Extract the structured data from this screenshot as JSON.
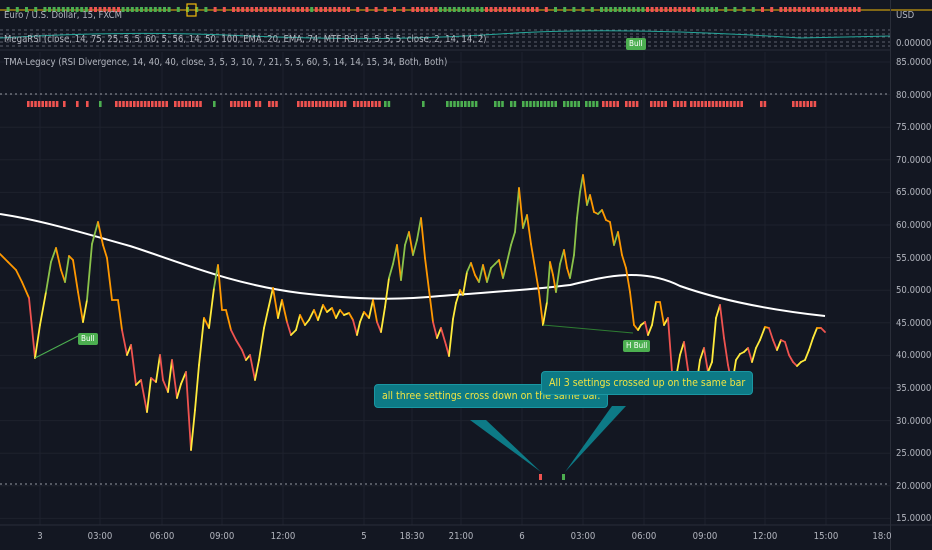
{
  "top_pane": {
    "symbol_legend": "Euro / U.S. Dollar, 15, FXCM",
    "megarsi_legend": "MegaRSI (close, 14, 75, 25, 5, 5, 60, 5, 56, 14, 50, 100, EMA, 20, EMA, 74, MTF RSI, 5, 5, 5, 5, close, 2, 14, 14, 2)",
    "currency_label": "USD",
    "zero_label": "0.00000",
    "megarsi_marker": "Bull"
  },
  "main_pane": {
    "indicator_legend": "TMA-Legacy (RSI Divergence, 14, 40, 40, close, 3, 5, 3, 10, 7, 21, 5, 5, 60, 5, 14, 14, 15, 34, Both, Both)"
  },
  "price_scale": [
    "85.00000",
    "80.00000",
    "75.00000",
    "70.00000",
    "65.00000",
    "60.00000",
    "55.00000",
    "50.00000",
    "45.00000",
    "40.00000",
    "35.00000",
    "30.00000",
    "25.00000",
    "20.00000",
    "15.00000"
  ],
  "time_axis": [
    "3",
    "03:00",
    "06:00",
    "09:00",
    "12:00",
    "5",
    "18:30",
    "21:00",
    "6",
    "03:00",
    "06:00",
    "09:00",
    "12:00",
    "15:00",
    "18:0"
  ],
  "markers": {
    "bull_label": "Bull",
    "hidden_bull_label": "H Bull"
  },
  "callouts": {
    "cross_down": "all three settings cross down on the same bar.",
    "cross_up": "All 3 settings crossed up on the same bar"
  },
  "colors": {
    "background": "#131722",
    "bull_green": "#4caf50",
    "bear_red": "#ef5350",
    "rsi_yellow": "#ffeb3b",
    "rsi_orange": "#ff9800",
    "rsi_green": "#8bc34a",
    "ma_white": "#ffffff",
    "callout_bg": "#0d7a86",
    "callout_text": "#f0e442"
  }
}
